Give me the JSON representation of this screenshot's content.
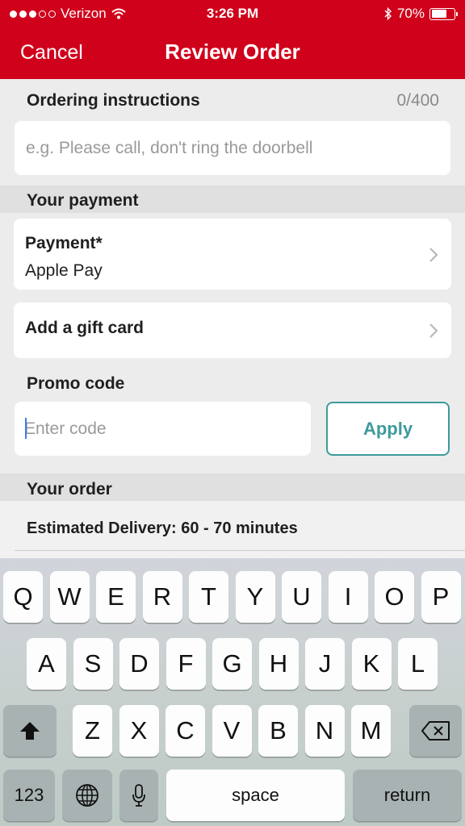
{
  "status_bar": {
    "carrier": "Verizon",
    "time": "3:26 PM",
    "battery": "70%",
    "battery_level": 0.7
  },
  "nav": {
    "cancel_label": "Cancel",
    "title": "Review Order"
  },
  "instructions": {
    "label": "Ordering instructions",
    "counter": "0/400",
    "placeholder": "e.g. Please call, don't ring the doorbell",
    "value": ""
  },
  "payment_section": {
    "label": "Your payment",
    "payment": {
      "title": "Payment*",
      "value": "Apple Pay"
    },
    "gift_card": {
      "title": "Add a gift card"
    }
  },
  "promo": {
    "label": "Promo code",
    "placeholder": "Enter code",
    "value": "",
    "apply_label": "Apply"
  },
  "order_section": {
    "label": "Your order",
    "delivery": "Estimated Delivery: 60 - 70 minutes"
  },
  "keyboard": {
    "row1": [
      "Q",
      "W",
      "E",
      "R",
      "T",
      "Y",
      "U",
      "I",
      "O",
      "P"
    ],
    "row2": [
      "A",
      "S",
      "D",
      "F",
      "G",
      "H",
      "J",
      "K",
      "L"
    ],
    "row3": [
      "Z",
      "X",
      "C",
      "V",
      "B",
      "N",
      "M"
    ],
    "numbers_label": "123",
    "space_label": "space",
    "return_label": "return",
    "icons": {
      "shift": "shift-icon",
      "delete": "delete-icon",
      "globe": "globe-icon",
      "mic": "microphone-icon"
    }
  },
  "colors": {
    "brand_red": "#d0021b",
    "accent_teal": "#3d9a9b"
  }
}
